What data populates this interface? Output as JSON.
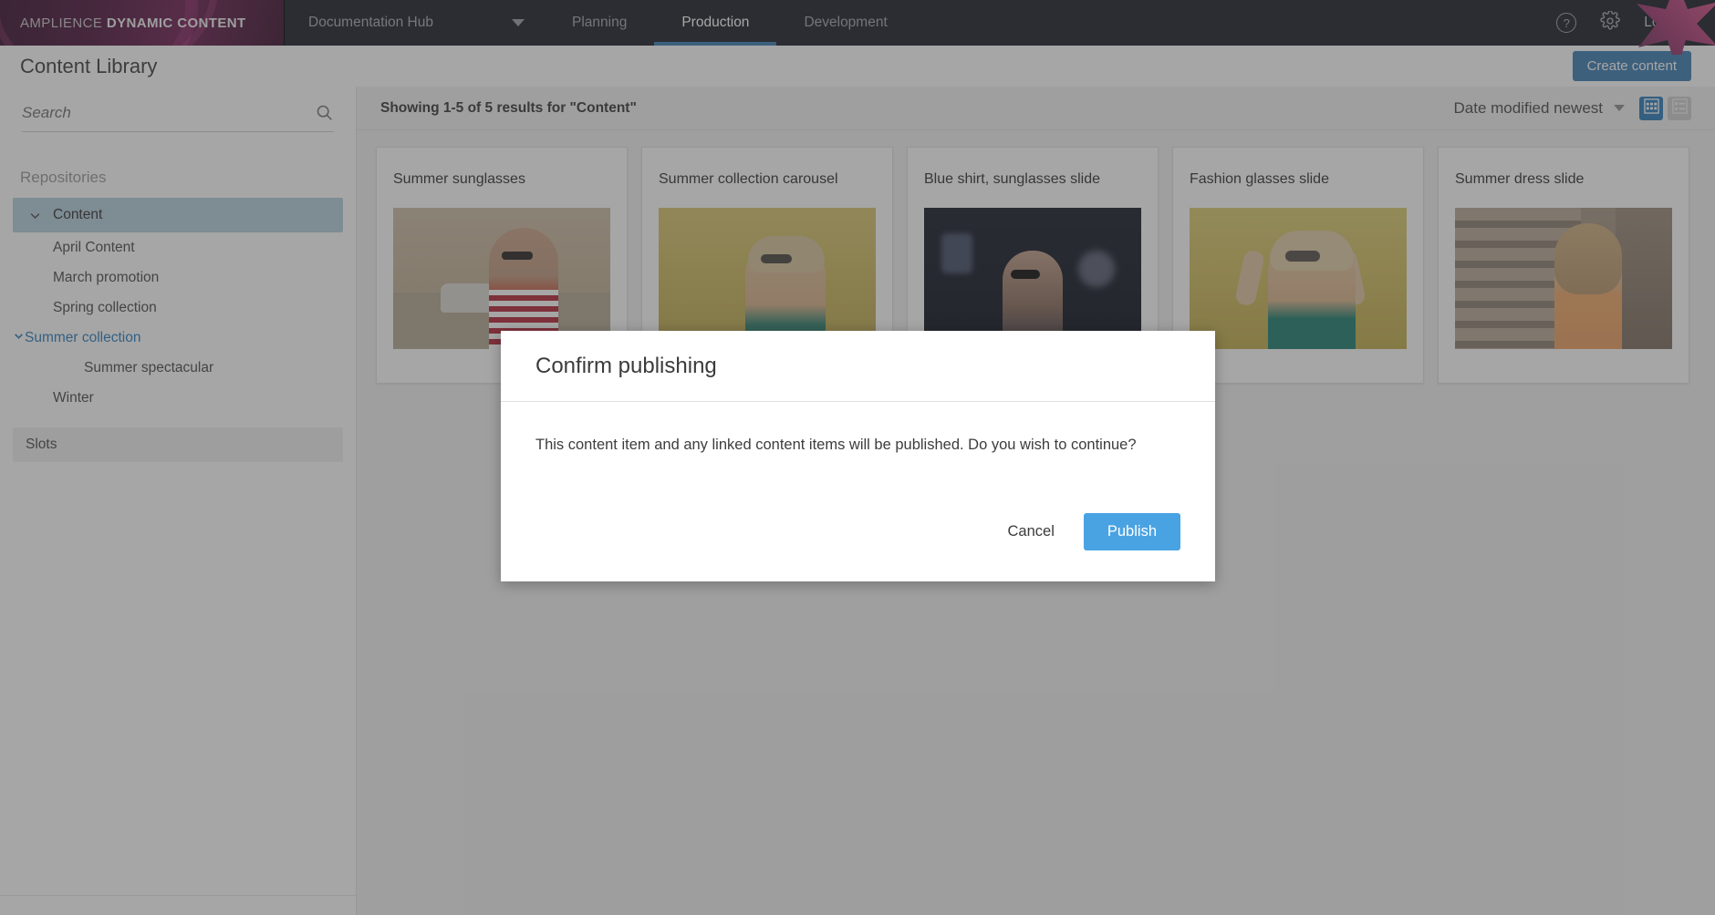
{
  "topnav": {
    "brand_light": "AMPLIENCE ",
    "brand_bold": "DYNAMIC CONTENT",
    "hub_label": "Documentation Hub",
    "tabs": [
      {
        "label": "Planning",
        "active": false
      },
      {
        "label": "Production",
        "active": true
      },
      {
        "label": "Development",
        "active": false
      }
    ],
    "help_icon": "help-circle-icon",
    "settings_icon": "gear-icon",
    "logout_label": "Log out"
  },
  "titlebar": {
    "page_title": "Content Library",
    "create_label": "Create content"
  },
  "sidebar": {
    "search_placeholder": "Search",
    "search_value": "",
    "search_icon": "search-icon",
    "section_label": "Repositories",
    "repository": {
      "label": "Content",
      "selected": true,
      "expanded": true
    },
    "folders": [
      {
        "label": "April Content",
        "level": 1,
        "active": false,
        "expanded": false
      },
      {
        "label": "March promotion",
        "level": 1,
        "active": false,
        "expanded": false
      },
      {
        "label": "Spring collection",
        "level": 1,
        "active": false,
        "expanded": false
      },
      {
        "label": "Summer collection",
        "level": 1,
        "active": true,
        "expanded": true
      },
      {
        "label": "Summer spectacular",
        "level": 2,
        "active": false,
        "expanded": false
      },
      {
        "label": "Winter",
        "level": 1,
        "active": false,
        "expanded": false
      }
    ],
    "slots_label": "Slots"
  },
  "main": {
    "results_text": "Showing 1-5 of 5 results for \"Content\"",
    "sort_value": "Date modified newest",
    "view_grid_icon": "grid-view-icon",
    "view_list_icon": "list-view-icon",
    "active_view": "grid",
    "cards": [
      {
        "title": "Summer sunglasses",
        "thumb": "th1"
      },
      {
        "title": "Summer collection carousel",
        "thumb": "th2"
      },
      {
        "title": "Blue shirt, sunglasses slide",
        "thumb": "th3"
      },
      {
        "title": "Fashion glasses slide",
        "thumb": "th4"
      },
      {
        "title": "Summer dress slide",
        "thumb": "th5"
      }
    ]
  },
  "modal": {
    "title": "Confirm publishing",
    "message": "This content item and any linked content items will be published. Do you wish to continue?",
    "cancel_label": "Cancel",
    "publish_label": "Publish"
  },
  "colors": {
    "accent_blue": "#3d7eb3",
    "publish_blue": "#49a3e3",
    "brand_magenta": "#6d1f52",
    "selected_row": "#b6cfdd",
    "active_link": "#2b7fc0"
  }
}
